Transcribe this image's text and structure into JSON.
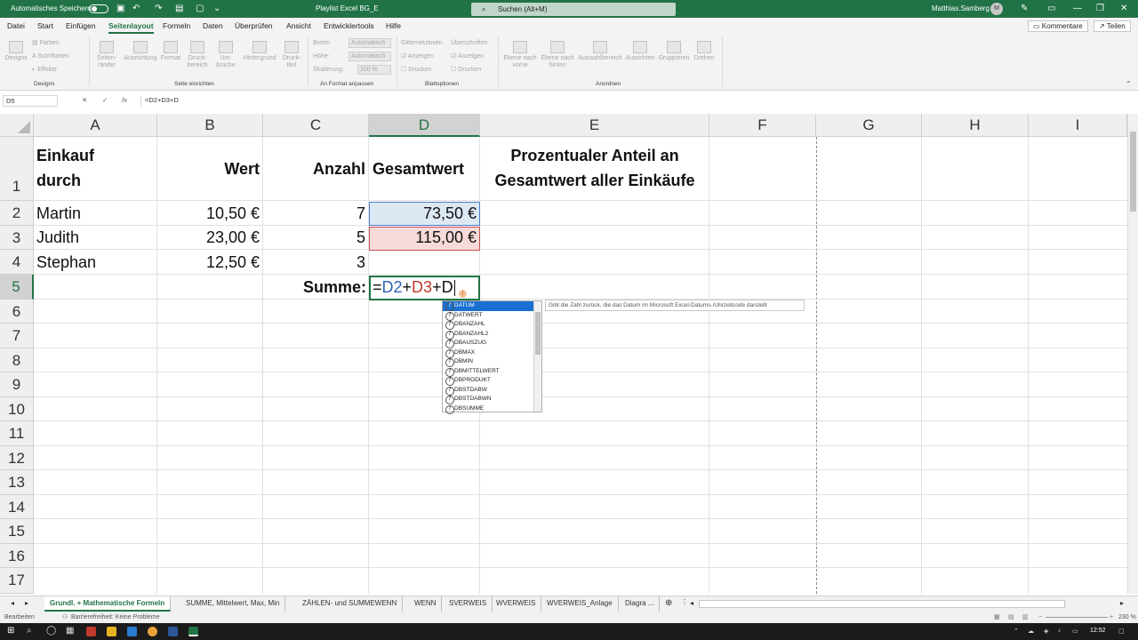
{
  "titlebar": {
    "autosave_label": "Automatisches Speichern",
    "title": "Playlist Excel BG_E",
    "search_placeholder": "Suchen (Alt+M)",
    "user": "Matthias.Samberg",
    "avatar": "M"
  },
  "menu": {
    "items": [
      "Datei",
      "Start",
      "Einfügen",
      "Seitenlayout",
      "Formeln",
      "Daten",
      "Überprüfen",
      "Ansicht",
      "Entwicklertools",
      "Hilfe"
    ],
    "active": "Seitenlayout",
    "comments": "Kommentare",
    "share": "Teilen"
  },
  "ribbon": {
    "designs": {
      "big": "Designs",
      "colors": "Farben",
      "fonts": "Schriftarten",
      "effects": "Effekte",
      "group": "Designs"
    },
    "page_setup": {
      "margins": "Seiten-ränder",
      "orientation": "Ausrichtung",
      "format": "Format",
      "print_area": "Druck-bereich",
      "breaks": "Um-brüche",
      "background": "Hintergrund",
      "print_titles": "Druck-titel",
      "group": "Seite einrichten"
    },
    "scale": {
      "width": "Breite:",
      "height": "Höhe:",
      "scaling": "Skalierung:",
      "auto": "Automatisch",
      "pct": "100 %",
      "group": "An Format anpassen"
    },
    "sheet_options": {
      "gridlines": "Gitternetzlinien",
      "headings": "Überschriften",
      "view": "Anzeigen",
      "print": "Drucken",
      "group": "Blattoptionen"
    },
    "arrange": {
      "forward": "Ebene nach vorne",
      "backward": "Ebene nach hinten",
      "selection": "Auswahlbereich",
      "align": "Ausrichten",
      "group_btn": "Gruppieren",
      "rotate": "Drehen",
      "group": "Anordnen"
    }
  },
  "formula_bar": {
    "name_box": "D5",
    "formula": "=D2+D3+D"
  },
  "columns": [
    "A",
    "B",
    "C",
    "D",
    "E",
    "F",
    "G",
    "H",
    "I"
  ],
  "rows": [
    "1",
    "2",
    "3",
    "4",
    "5",
    "6",
    "7",
    "8",
    "9",
    "10",
    "11",
    "12",
    "13",
    "14",
    "15",
    "16",
    "17"
  ],
  "cells": {
    "A1a": "Einkauf",
    "A1b": "durch",
    "B1": "Wert",
    "C1": "Anzahl",
    "D1": "Gesamtwert",
    "E1a": "Prozentualer Anteil an",
    "E1b": "Gesamtwert aller Einkäufe",
    "A2": "Martin",
    "B2": "10,50 €",
    "C2": "7",
    "D2": "73,50 €",
    "A3": "Judith",
    "B3": "23,00 €",
    "C3": "5",
    "D3": "115,00 €",
    "A4": "Stephan",
    "B4": "12,50 €",
    "C4": "3",
    "C5": "Summe:"
  },
  "edit": {
    "eq": "=",
    "ref1": "D2",
    "plus1": "+",
    "ref2": "D3",
    "plus2": "+",
    "tail": "D"
  },
  "autocomplete": {
    "items": [
      "DATUM",
      "DATWERT",
      "DBANZAHL",
      "DBANZAHL2",
      "DBAUSZUG",
      "DBMAX",
      "DBMIN",
      "DBMITTELWERT",
      "DBPRODUKT",
      "DBSTDABW",
      "DBSTDABWN",
      "DBSUMME"
    ],
    "tooltip": "Gibt die Zahl zurück, die das Datum im Microsoft Excel-Datums-/Uhrzeitcode darstellt"
  },
  "sheets": [
    "Grundl. + Mathematische Formeln",
    "SUMME, Mittelwert, Max, Min",
    "ZÄHLEN- und SUMMEWENN",
    "WENN",
    "SVERWEIS",
    "WVERWEIS",
    "WVERWEIS_Anlage",
    "Diagra ..."
  ],
  "status": {
    "mode": "Bearbeiten",
    "accessibility": "Barrierefreiheit: Keine Probleme",
    "zoom": "230 %"
  },
  "taskbar": {
    "time": "12:52"
  }
}
